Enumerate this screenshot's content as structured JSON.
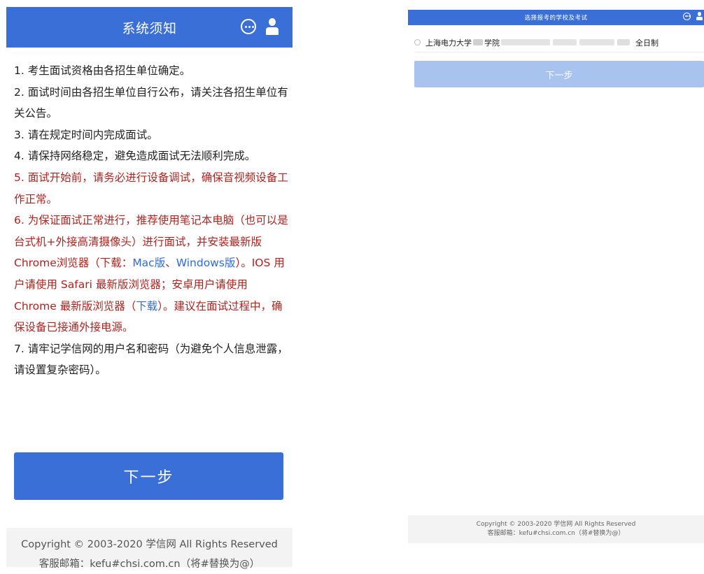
{
  "left_panel": {
    "header": {
      "title": "系统须知",
      "icons": [
        "chat-icon",
        "user-icon"
      ],
      "color": "#3a6fd8"
    },
    "notice": {
      "item1": "1. 考生面试资格由各招生单位确定。",
      "item2": "2. 面试时间由各招生单位自行公布，请关注各招生单位有关公告。",
      "item3": "3. 请在规定时间内完成面试。",
      "item4": "4. 请保持网络稳定，避免造成面试无法顺利完成。",
      "item5": "5. 面试开始前，请务必进行设备调试，确保音视频设备工作正常。",
      "item6_a": "6. 为保证面试正常进行，推荐使用笔记本电脑（也可以是台式机+外接高清摄像头）进行面试，并安装最新版Chrome浏览器（下载：",
      "item6_mac": "Mac版",
      "item6_sep": "、",
      "item6_win": "Windows版",
      "item6_b": "）。IOS 用户请使用 Safari 最新版浏览器；安卓用户请使用 Chrome 最新版浏览器（",
      "item6_download": "下载",
      "item6_c": "）。建议在面试过程中，确保设备已接通外接电源。",
      "item7": "7. 请牢记学信网的用户名和密码（为避免个人信息泄露，请设置复杂密码）。",
      "accent_color": "#b0231e",
      "link_color": "#2f6bd8"
    },
    "next_button": "下一步",
    "footer": {
      "copyright": "Copyright © 2003-2020 学信网 All Rights Reserved",
      "email": "客服邮箱：kefu#chsi.com.cn（将#替换为@）"
    }
  },
  "right_panel": {
    "header": {
      "title": "选择报考的学校及考试",
      "icons": [
        "chat-icon",
        "user-icon"
      ]
    },
    "option": {
      "school": "上海电力大学",
      "college_suffix": "学院",
      "mode": "全日制"
    },
    "next_button": "下一步",
    "next_button_color": "#a9c3ef",
    "footer": {
      "copyright": "Copyright © 2003-2020 学信网 All Rights Reserved",
      "email": "客服邮箱：kefu#chsi.com.cn（将#替换为@）"
    }
  }
}
